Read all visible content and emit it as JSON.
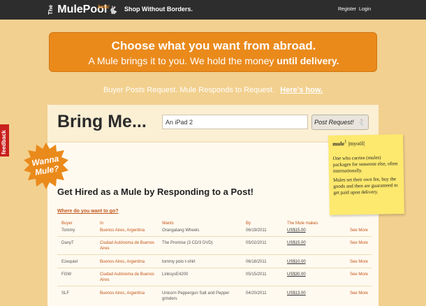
{
  "header": {
    "logo_the": "The",
    "logo_name": "MulePool",
    "logo_beta": "beta!",
    "tagline": "Shop Without Borders.",
    "register": "Register",
    "login": "Login"
  },
  "hero": {
    "line1": "Choose what you want from abroad.",
    "line2_start": "A Mule brings it to you. We hold the money ",
    "line2_bold": "until delivery."
  },
  "subline": {
    "text": "Buyer Posts Request. Mule Responds to Request.",
    "link": "Here's how."
  },
  "feedback": "feedback",
  "request": {
    "title": "Bring Me...",
    "input_value": "An iPad 2",
    "button": "Post Request!"
  },
  "badge": {
    "line1": "Wanna",
    "line2": "Mule?"
  },
  "definition": {
    "word": "mule",
    "sup": "1",
    "pron": "|myoōl|",
    "def1": "One who carries (mules) packages for someone else, often internationally.",
    "def2": "Mules set their own fee, buy the goods and then are guaranteed to get paid upon delivery."
  },
  "listing": {
    "heading": "Get Hired as a Mule by Responding to a Post!",
    "where_link": "Where do you want to go?",
    "columns": {
      "buyer": "Buyer",
      "in": "In",
      "wants": "Wants",
      "by": "By",
      "makes": "The Mule makes"
    },
    "rows": [
      {
        "buyer": "Tommy",
        "in": "Buenos Aires, Argentina",
        "wants": "Orangatang Wheels",
        "by": "06/19/2011",
        "makes": "US$15.00",
        "more": "See More"
      },
      {
        "buyer": "DanyT",
        "in": "Ciudad Autónoma de Buenos Aires",
        "wants": "The Promise (3 CD/3 DVD)",
        "by": "05/02/2011",
        "makes": "US$15.00",
        "more": "See More"
      },
      {
        "buyer": "Ezequiel",
        "in": "Buenos Aires, Argentina",
        "wants": "tommy polo t-shirt",
        "by": "06/18/2011",
        "makes": "US$10.00",
        "more": "See More"
      },
      {
        "buyer": "FGW",
        "in": "Ciudad Autónoma de Buenos Aires",
        "wants": "LinksysE4200",
        "by": "05/15/2011",
        "makes": "US$30.00",
        "more": "See More"
      },
      {
        "buyer": "SLF",
        "in": "Buenos Aires, Argentina",
        "wants": "Unicorn Peppergun Salt and Pepper grinders",
        "by": "04/20/2011",
        "makes": "US$13.00",
        "more": "See More"
      }
    ]
  },
  "colors": {
    "accent": "#ea8a1b",
    "link": "#c2561a",
    "topbar": "#2d2d2d",
    "sticky": "#fde96e"
  }
}
